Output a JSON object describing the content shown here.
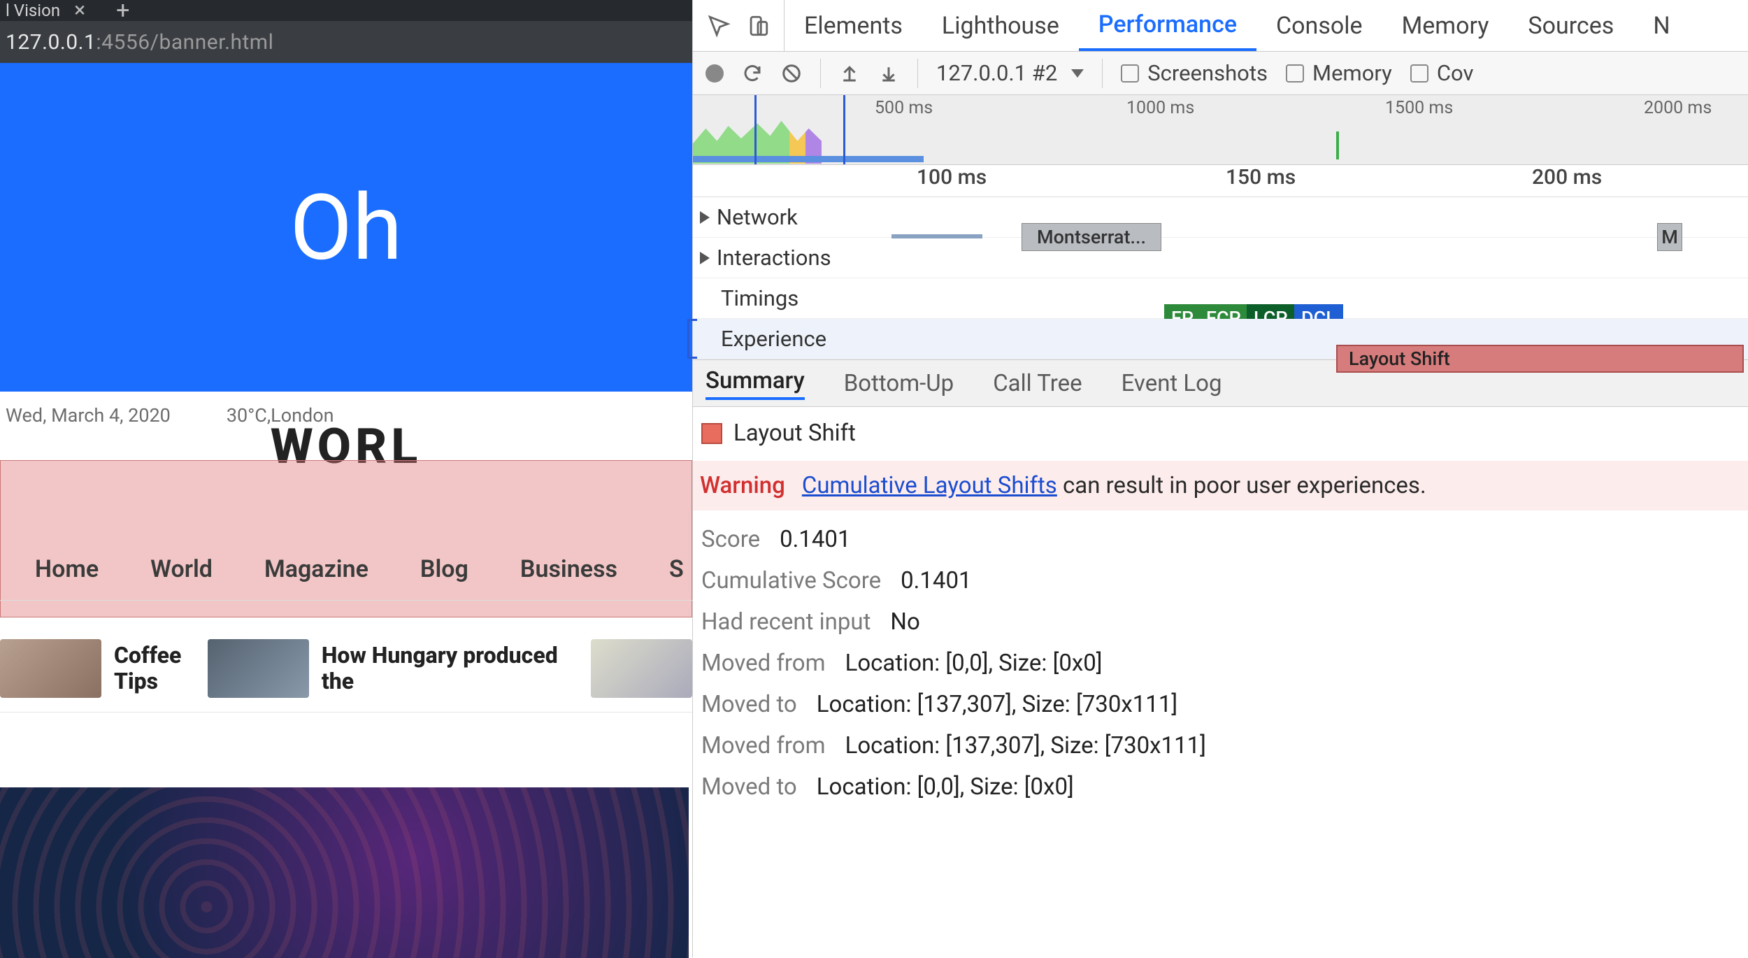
{
  "browser": {
    "tab_title": "l Vision",
    "address_host": "127.0.0.1",
    "address_path": ":4556/banner.html",
    "banner_text": "Oh",
    "date_text": "Wed, March 4, 2020",
    "weather_text": "30°C,London",
    "site_title": "WORL",
    "nav_items": [
      "Home",
      "World",
      "Magazine",
      "Blog",
      "Business",
      "S"
    ],
    "ticker": [
      {
        "title": "Coffee Tips"
      },
      {
        "title": "How Hungary produced the"
      }
    ]
  },
  "devtools": {
    "tabs": [
      "Elements",
      "Lighthouse",
      "Performance",
      "Console",
      "Memory",
      "Sources",
      "N"
    ],
    "active_tab": "Performance",
    "toolbar": {
      "dropdown": "127.0.0.1 #2",
      "chk_screenshots": "Screenshots",
      "chk_memory": "Memory",
      "chk_cov": "Cov"
    },
    "overview_ticks": [
      "500 ms",
      "1000 ms",
      "1500 ms",
      "2000 ms"
    ],
    "ruler_ticks": [
      "100 ms",
      "150 ms",
      "200 ms"
    ],
    "tracks": {
      "network_label": "Network",
      "network_chip": "Montserrat...",
      "network_chip2": "M",
      "interactions_label": "Interactions",
      "timings_label": "Timings",
      "timings_chips": [
        "FP",
        "FCP",
        "LCP",
        "DCL"
      ],
      "experience_label": "Experience",
      "experience_chip": "Layout Shift"
    },
    "subtabs": [
      "Summary",
      "Bottom-Up",
      "Call Tree",
      "Event Log"
    ],
    "active_subtab": "Summary",
    "detail": {
      "heading": "Layout Shift",
      "warn_label": "Warning",
      "warn_link": "Cumulative Layout Shifts",
      "warn_rest": "can result in poor user experiences.",
      "rows": [
        {
          "k": "Score",
          "v": "0.1401"
        },
        {
          "k": "Cumulative Score",
          "v": "0.1401"
        },
        {
          "k": "Had recent input",
          "v": "No"
        },
        {
          "k": "Moved from",
          "v": "Location: [0,0], Size: [0x0]"
        },
        {
          "k": "Moved to",
          "v": "Location: [137,307], Size: [730x111]"
        },
        {
          "k": "Moved from",
          "v": "Location: [137,307], Size: [730x111]"
        },
        {
          "k": "Moved to",
          "v": "Location: [0,0], Size: [0x0]"
        }
      ]
    }
  }
}
